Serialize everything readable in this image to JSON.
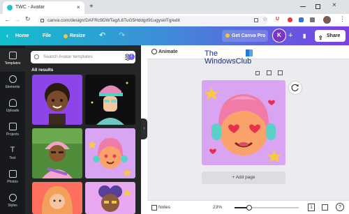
{
  "browser": {
    "tab_title": "TWC - Avatar",
    "tab_close": "×",
    "new_tab": "+",
    "url": "canva.com/design/DAFRc9DWTag/L6TuG5Hddgrl91ugysklTg/edit",
    "back": "←",
    "forward": "→",
    "reload": "↻"
  },
  "header": {
    "home_label": "Home",
    "file_label": "File",
    "resize_label": "Resize",
    "undo": "↶",
    "redo": "↷",
    "pro_label": "Get Canva Pro",
    "avatar_initial": "K",
    "plus": "+",
    "share_label": "Share",
    "chart_icon": "▮"
  },
  "rail": {
    "items": [
      {
        "label": "Templates"
      },
      {
        "label": "Elements"
      },
      {
        "label": "Uploads"
      },
      {
        "label": "Projects"
      },
      {
        "label": "Text"
      },
      {
        "label": "Photos"
      },
      {
        "label": "Styles"
      }
    ]
  },
  "panel": {
    "search_placeholder": "Search Avatar templates",
    "filter_badge": "1",
    "results_label": "All results"
  },
  "canvas": {
    "animate_label": "Animate",
    "watermark_line1": "The",
    "watermark_line2": "WindowsClub",
    "add_page_label": "+ Add page"
  },
  "bottom": {
    "notes_label": "Notes",
    "zoom_label": "23%",
    "zoom_level": 0.23,
    "page_count": "1"
  },
  "colors": {
    "header_gradient_start": "#11bfcc",
    "header_gradient_end": "#7b3fe4",
    "panel_bg": "#252627",
    "rail_bg": "#17191c",
    "design_bg": "#d9a4f2"
  }
}
